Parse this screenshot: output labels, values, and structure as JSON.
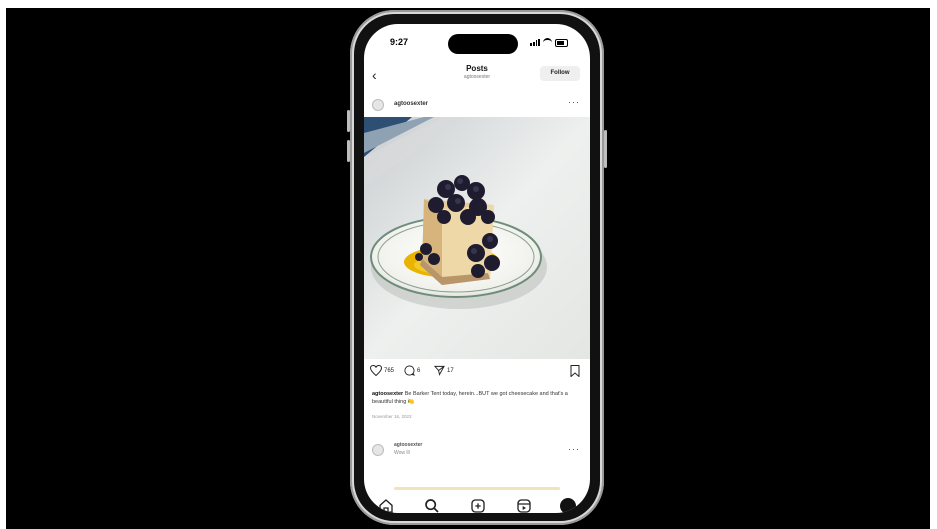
{
  "status_bar": {
    "time": "9:27"
  },
  "nav": {
    "back_icon": "chevron-left-icon",
    "title": "Posts",
    "subtitle": "agtoosexter",
    "follow_label": "Follow"
  },
  "post": {
    "username": "agtoosexter",
    "likes": "765",
    "comments": "6",
    "shares": "17",
    "caption_user": "agtoosexter",
    "caption_text": "Be Barker Tent today, herein...BUT we got cheesecake and that's a beautiful thing 🍋",
    "date": "November 16, 2023"
  },
  "comment": {
    "username": "agtoosexter",
    "text": "Wow lll"
  },
  "colors": {
    "frame": "#d8d8d8",
    "background": "#000000",
    "screen": "#ffffff",
    "sauce": "#e8b400",
    "plate_rim": "#6e8c7a"
  },
  "icons": [
    "heart-icon",
    "comment-icon",
    "share-icon",
    "bookmark-icon",
    "home-icon",
    "search-icon",
    "create-icon",
    "reels-icon",
    "profile-icon"
  ]
}
